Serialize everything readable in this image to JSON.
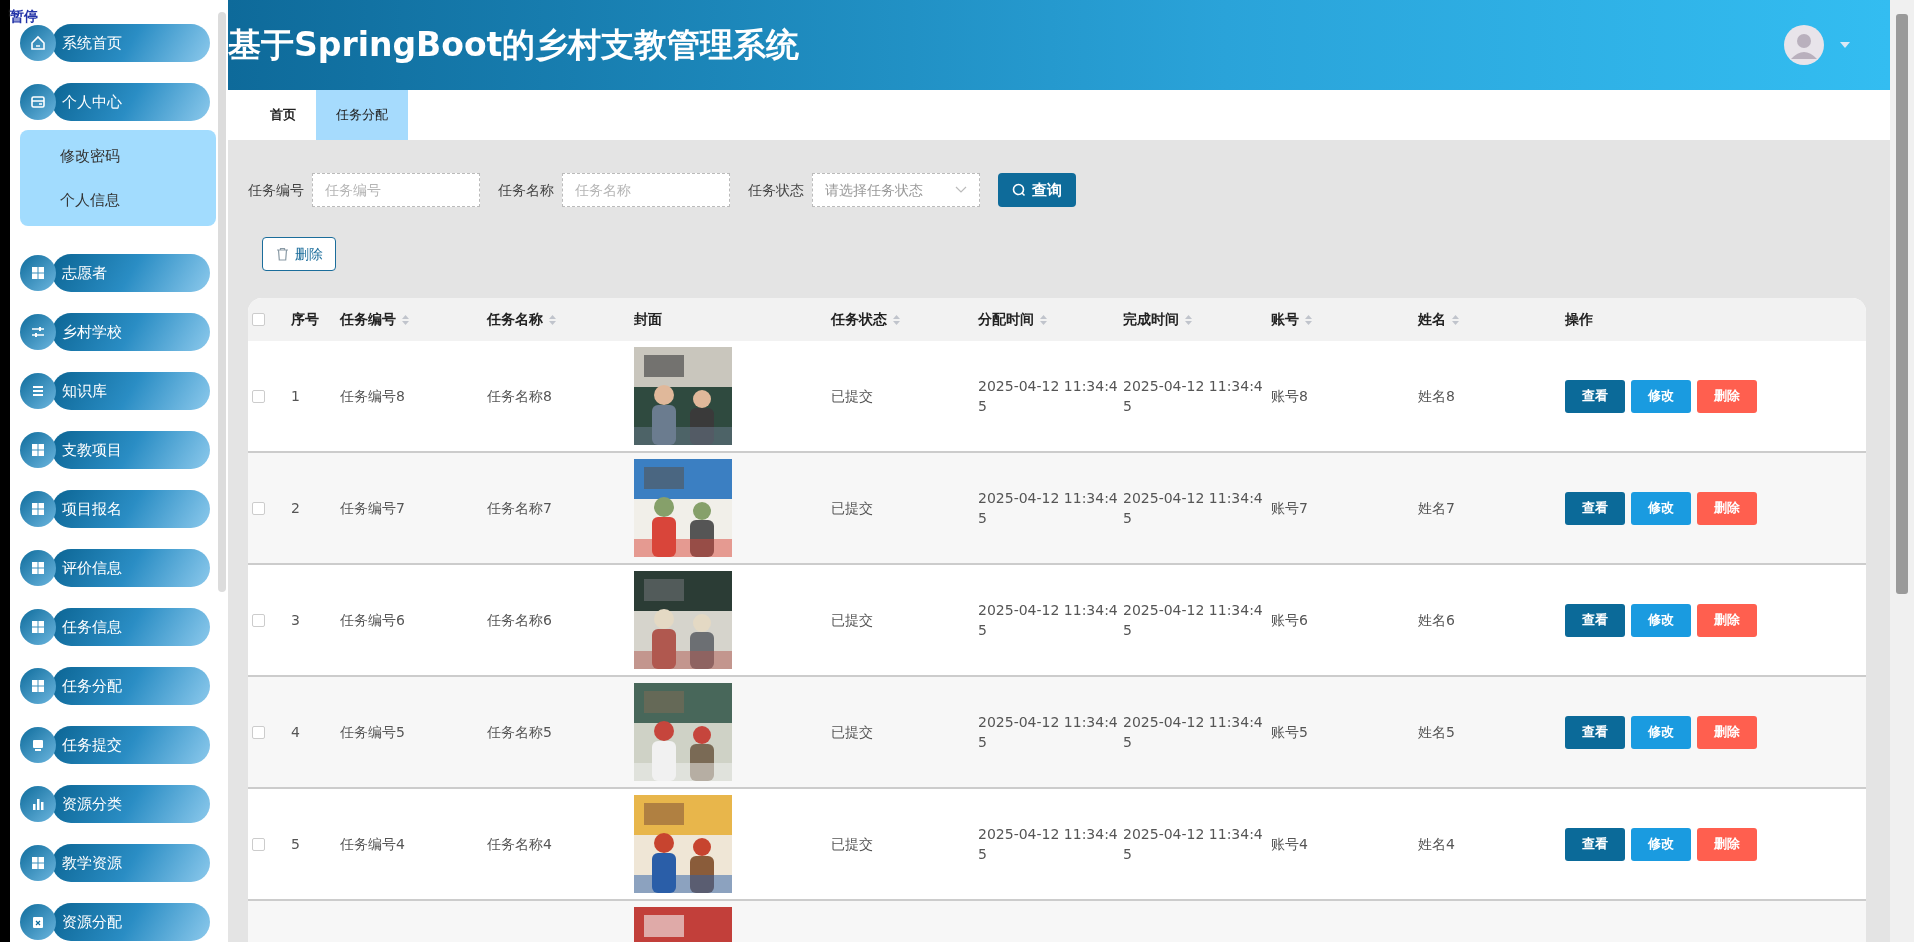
{
  "overlay_label": "暂停",
  "sidebar": {
    "items": [
      {
        "label": "系统首页"
      },
      {
        "label": "个人中心",
        "children": [
          {
            "label": "修改密码"
          },
          {
            "label": "个人信息"
          }
        ]
      },
      {
        "label": "志愿者"
      },
      {
        "label": "乡村学校"
      },
      {
        "label": "知识库"
      },
      {
        "label": "支教项目"
      },
      {
        "label": "项目报名"
      },
      {
        "label": "评价信息"
      },
      {
        "label": "任务信息"
      },
      {
        "label": "任务分配"
      },
      {
        "label": "任务提交"
      },
      {
        "label": "资源分类"
      },
      {
        "label": "教学资源"
      },
      {
        "label": "资源分配"
      }
    ]
  },
  "header": {
    "title": "基于SpringBoot的乡村支教管理系统"
  },
  "tabs": [
    {
      "label": "首页",
      "selected": false
    },
    {
      "label": "任务分配",
      "selected": true
    }
  ],
  "search": {
    "fields": [
      {
        "label": "任务编号",
        "placeholder": "任务编号",
        "kind": "text"
      },
      {
        "label": "任务名称",
        "placeholder": "任务名称",
        "kind": "text"
      },
      {
        "label": "任务状态",
        "placeholder": "请选择任务状态",
        "kind": "select"
      }
    ],
    "button": "查询"
  },
  "toolbar": {
    "delete_button": "删除"
  },
  "table": {
    "columns": [
      {
        "label": "序号",
        "sortable": false
      },
      {
        "label": "任务编号",
        "sortable": true
      },
      {
        "label": "任务名称",
        "sortable": true
      },
      {
        "label": "封面",
        "sortable": false
      },
      {
        "label": "任务状态",
        "sortable": true
      },
      {
        "label": "分配时间",
        "sortable": true
      },
      {
        "label": "完成时间",
        "sortable": true
      },
      {
        "label": "账号",
        "sortable": true
      },
      {
        "label": "姓名",
        "sortable": true
      },
      {
        "label": "操作",
        "sortable": false
      }
    ],
    "all_checked": false,
    "rows": [
      {
        "index": "1",
        "task_no": "任务编号8",
        "task_name": "任务名称8",
        "cover": {
          "kind": "picture"
        },
        "status": "已提交",
        "assigned": "2025-04-12 11:34:45",
        "finished": "2025-04-12 11:34:45",
        "account": "账号8",
        "name": "姓名8",
        "checked": false,
        "actions": [
          "查看",
          "修改",
          "删除"
        ]
      },
      {
        "index": "2",
        "task_no": "任务编号7",
        "task_name": "任务名称7",
        "cover": {
          "kind": "picture"
        },
        "status": "已提交",
        "assigned": "2025-04-12 11:34:45",
        "finished": "2025-04-12 11:34:45",
        "account": "账号7",
        "name": "姓名7",
        "checked": false,
        "actions": [
          "查看",
          "修改",
          "删除"
        ]
      },
      {
        "index": "3",
        "task_no": "任务编号6",
        "task_name": "任务名称6",
        "cover": {
          "kind": "picture"
        },
        "status": "已提交",
        "assigned": "2025-04-12 11:34:45",
        "finished": "2025-04-12 11:34:45",
        "account": "账号6",
        "name": "姓名6",
        "checked": false,
        "actions": [
          "查看",
          "修改",
          "删除"
        ]
      },
      {
        "index": "4",
        "task_no": "任务编号5",
        "task_name": "任务名称5",
        "cover": {
          "kind": "picture"
        },
        "status": "已提交",
        "assigned": "2025-04-12 11:34:45",
        "finished": "2025-04-12 11:34:45",
        "account": "账号5",
        "name": "姓名5",
        "checked": false,
        "actions": [
          "查看",
          "修改",
          "删除"
        ]
      },
      {
        "index": "5",
        "task_no": "任务编号4",
        "task_name": "任务名称4",
        "cover": {
          "kind": "picture"
        },
        "status": "已提交",
        "assigned": "2025-04-12 11:34:45",
        "finished": "2025-04-12 11:34:45",
        "account": "账号4",
        "name": "姓名4",
        "checked": false,
        "actions": [
          "查看",
          "修改",
          "删除"
        ]
      },
      {
        "cover": {
          "kind": "picture"
        }
      }
    ]
  }
}
